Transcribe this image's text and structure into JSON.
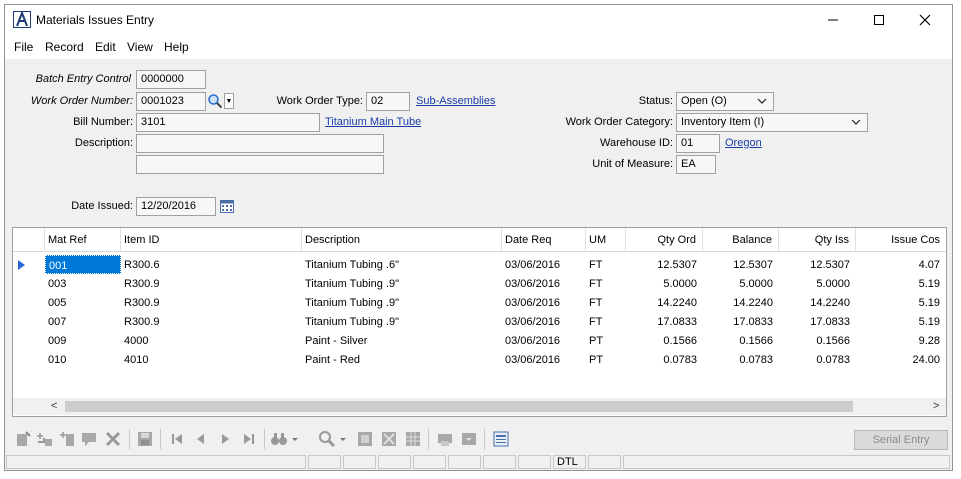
{
  "window": {
    "title": "Materials Issues Entry",
    "minimize": "—",
    "maximize": "☐",
    "close": "✕"
  },
  "menu": [
    "File",
    "Record",
    "Edit",
    "View",
    "Help"
  ],
  "form": {
    "batch_entry_control": {
      "label": "Batch Entry Control",
      "value": "0000000"
    },
    "work_order_number": {
      "label": "Work Order Number:",
      "value": "0001023"
    },
    "work_order_type": {
      "label": "Work Order Type:",
      "value": "02",
      "link": "Sub-Assemblies"
    },
    "status": {
      "label": "Status:",
      "value": "Open (O)"
    },
    "bill_number": {
      "label": "Bill Number:",
      "value": "3101",
      "link": "Titanium Main Tube"
    },
    "work_order_category": {
      "label": "Work Order Category:",
      "value": "Inventory Item (I)"
    },
    "description": {
      "label": "Description:",
      "line1": "",
      "line2": ""
    },
    "warehouse_id": {
      "label": "Warehouse ID:",
      "value": "01",
      "link": "Oregon"
    },
    "unit_of_measure": {
      "label": "Unit of Measure:",
      "value": "EA"
    },
    "date_issued": {
      "label": "Date Issued:",
      "value": "12/20/2016"
    }
  },
  "grid": {
    "columns": [
      "Mat Ref",
      "Item ID",
      "Description",
      "Date Req",
      "UM",
      "Qty Ord",
      "Balance",
      "Qty Iss",
      "Issue Cos"
    ],
    "rows": [
      [
        "001",
        "R300.6",
        "Titanium Tubing .6\"",
        "03/06/2016",
        "FT",
        "12.5307",
        "12.5307",
        "12.5307",
        "4.07"
      ],
      [
        "003",
        "R300.9",
        "Titanium Tubing .9\"",
        "03/06/2016",
        "FT",
        "5.0000",
        "5.0000",
        "5.0000",
        "5.19"
      ],
      [
        "005",
        "R300.9",
        "Titanium Tubing .9\"",
        "03/06/2016",
        "FT",
        "14.2240",
        "14.2240",
        "14.2240",
        "5.19"
      ],
      [
        "007",
        "R300.9",
        "Titanium Tubing .9\"",
        "03/06/2016",
        "FT",
        "17.0833",
        "17.0833",
        "17.0833",
        "5.19"
      ],
      [
        "009",
        "4000",
        "Paint - Silver",
        "03/06/2016",
        "PT",
        "0.1566",
        "0.1566",
        "0.1566",
        "9.28"
      ],
      [
        "010",
        "4010",
        "Paint - Red",
        "03/06/2016",
        "PT",
        "0.0783",
        "0.0783",
        "0.0783",
        "24.00"
      ]
    ],
    "scroll_left": "<",
    "scroll_right": ">"
  },
  "toolbar": {
    "serial_entry": "Serial Entry",
    "icons": [
      "new-record-icon",
      "add-line-icon",
      "insert-line-icon",
      "note-icon",
      "delete-icon",
      "save-icon",
      "first-record-icon",
      "previous-record-icon",
      "next-record-icon",
      "last-record-icon",
      "find-icon",
      "zoom-icon",
      "edit-icon",
      "expand-icon",
      "grid-icon",
      "print-icon",
      "print-dropdown-icon",
      "list-view-icon"
    ]
  },
  "statusbar": {
    "mode": "DTL"
  },
  "colors": {
    "selection": "#0078d7",
    "link": "#1a3da8",
    "background": "#f0f0f0",
    "row_indicator": "#2a6ad6"
  }
}
